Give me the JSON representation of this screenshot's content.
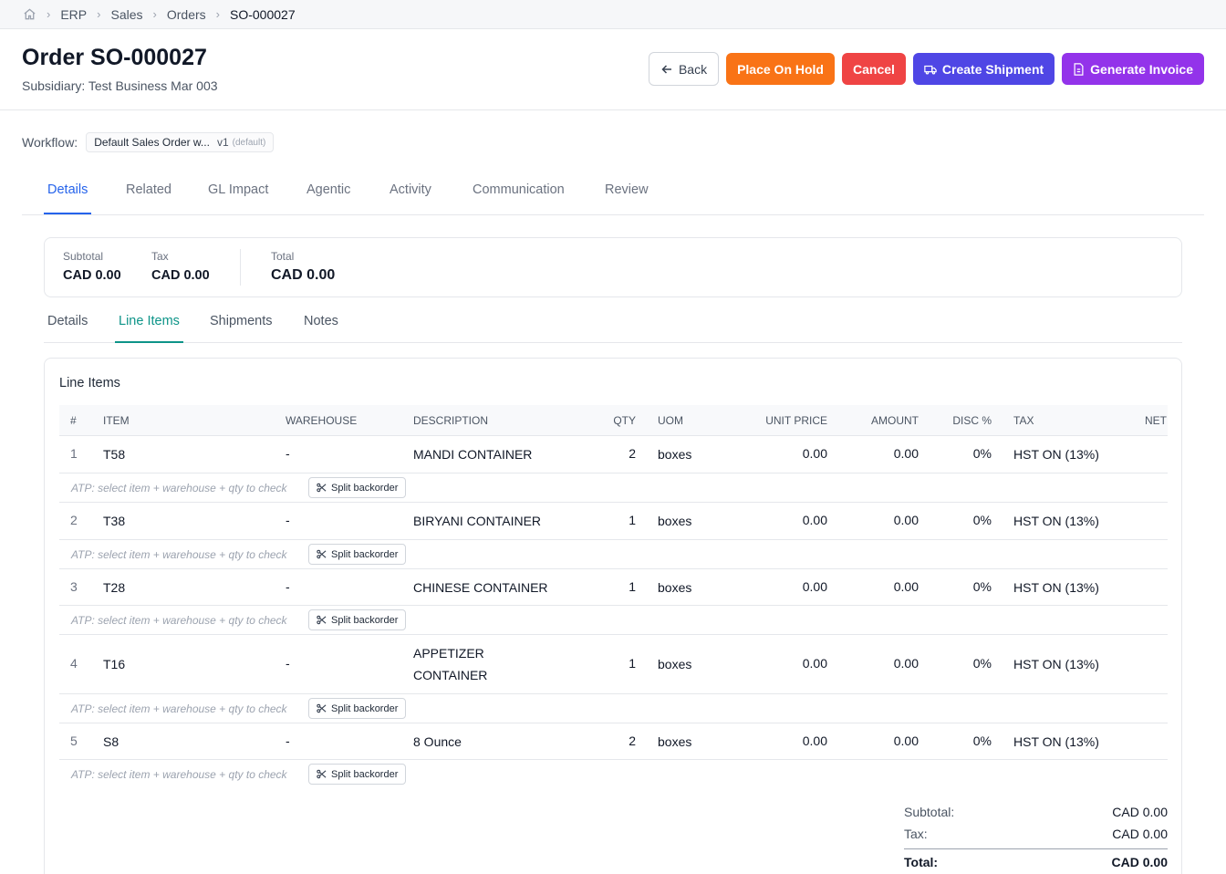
{
  "breadcrumb": [
    "ERP",
    "Sales",
    "Orders",
    "SO-000027"
  ],
  "header": {
    "title": "Order SO-000027",
    "subtitle": "Subsidiary: Test Business Mar 003",
    "actions": {
      "back": "Back",
      "hold": "Place On Hold",
      "cancel": "Cancel",
      "shipment": "Create Shipment",
      "invoice": "Generate Invoice"
    },
    "colors": {
      "hold": "#f97316",
      "cancel": "#ef4444",
      "shipment": "#4f46e5",
      "invoice": "#9333ea"
    }
  },
  "workflow": {
    "label": "Workflow:",
    "name": "Default Sales Order w...",
    "version": "v1",
    "tag": "(default)"
  },
  "tabs": [
    "Details",
    "Related",
    "GL Impact",
    "Agentic",
    "Activity",
    "Communication",
    "Review"
  ],
  "summary": {
    "subtotal_label": "Subtotal",
    "subtotal": "CAD 0.00",
    "tax_label": "Tax",
    "tax": "CAD 0.00",
    "total_label": "Total",
    "total": "CAD 0.00"
  },
  "subtabs": [
    "Details",
    "Line Items",
    "Shipments",
    "Notes"
  ],
  "line_items": {
    "title": "Line Items",
    "columns": [
      "#",
      "ITEM",
      "WAREHOUSE",
      "DESCRIPTION",
      "QTY",
      "UOM",
      "UNIT PRICE",
      "AMOUNT",
      "DISC %",
      "TAX",
      "NET"
    ],
    "rows": [
      {
        "n": "1",
        "item": "T58",
        "warehouse": "-",
        "desc": [
          "MANDI CONTAINER"
        ],
        "qty": "2",
        "uom": "boxes",
        "price": "0.00",
        "amount": "0.00",
        "disc": "0%",
        "tax": "HST ON (13%)"
      },
      {
        "n": "2",
        "item": "T38",
        "warehouse": "-",
        "desc": [
          "BIRYANI CONTAINER"
        ],
        "qty": "1",
        "uom": "boxes",
        "price": "0.00",
        "amount": "0.00",
        "disc": "0%",
        "tax": "HST ON (13%)"
      },
      {
        "n": "3",
        "item": "T28",
        "warehouse": "-",
        "desc": [
          "CHINESE CONTAINER"
        ],
        "qty": "1",
        "uom": "boxes",
        "price": "0.00",
        "amount": "0.00",
        "disc": "0%",
        "tax": "HST ON (13%)"
      },
      {
        "n": "4",
        "item": "T16",
        "warehouse": "-",
        "desc": [
          "APPETIZER",
          "CONTAINER"
        ],
        "qty": "1",
        "uom": "boxes",
        "price": "0.00",
        "amount": "0.00",
        "disc": "0%",
        "tax": "HST ON (13%)"
      },
      {
        "n": "5",
        "item": "S8",
        "warehouse": "-",
        "desc": [
          "8 Ounce"
        ],
        "qty": "2",
        "uom": "boxes",
        "price": "0.00",
        "amount": "0.00",
        "disc": "0%",
        "tax": "HST ON (13%)"
      }
    ],
    "atp_hint": "ATP: select item + warehouse + qty to check",
    "split_label": "Split backorder"
  },
  "totals": {
    "subtotal_label": "Subtotal:",
    "subtotal": "CAD 0.00",
    "tax_label": "Tax:",
    "tax": "CAD 0.00",
    "total_label": "Total:",
    "total": "CAD 0.00"
  }
}
